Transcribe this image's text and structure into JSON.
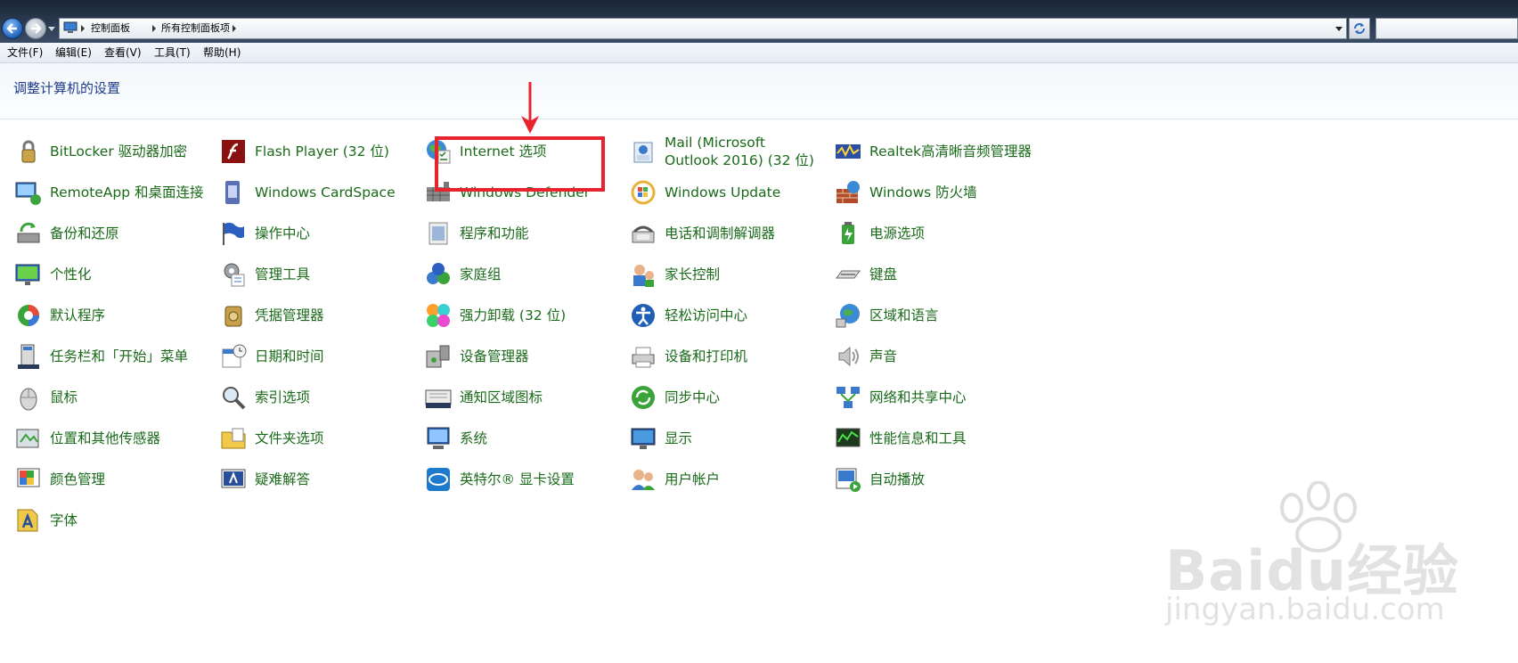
{
  "window": {
    "breadcrumb": [
      "控制面板",
      "所有控制面板项"
    ]
  },
  "menu": [
    "文件(F)",
    "编辑(E)",
    "查看(V)",
    "工具(T)",
    "帮助(H)"
  ],
  "heading": "调整计算机的设置",
  "items": [
    {
      "label": "BitLocker 驱动器加密",
      "icon": "bitlocker-icon"
    },
    {
      "label": "Flash Player (32 位)",
      "icon": "flash-icon"
    },
    {
      "label": "Internet 选项",
      "icon": "internet-options-icon"
    },
    {
      "label": "Mail (Microsoft Outlook 2016) (32 位)",
      "icon": "mail-icon"
    },
    {
      "label": "Realtek高清晰音频管理器",
      "icon": "realtek-audio-icon"
    },
    {
      "label": "RemoteApp 和桌面连接",
      "icon": "remoteapp-icon"
    },
    {
      "label": "Windows CardSpace",
      "icon": "cardspace-icon"
    },
    {
      "label": "Windows Defender",
      "icon": "defender-icon"
    },
    {
      "label": "Windows Update",
      "icon": "windows-update-icon"
    },
    {
      "label": "Windows 防火墙",
      "icon": "firewall-icon"
    },
    {
      "label": "备份和还原",
      "icon": "backup-icon"
    },
    {
      "label": "操作中心",
      "icon": "action-center-icon"
    },
    {
      "label": "程序和功能",
      "icon": "programs-icon"
    },
    {
      "label": "电话和调制解调器",
      "icon": "phone-modem-icon"
    },
    {
      "label": "电源选项",
      "icon": "power-icon"
    },
    {
      "label": "个性化",
      "icon": "personalization-icon"
    },
    {
      "label": "管理工具",
      "icon": "admin-tools-icon"
    },
    {
      "label": "家庭组",
      "icon": "homegroup-icon"
    },
    {
      "label": "家长控制",
      "icon": "parental-controls-icon"
    },
    {
      "label": "键盘",
      "icon": "keyboard-icon"
    },
    {
      "label": "默认程序",
      "icon": "default-programs-icon"
    },
    {
      "label": "凭据管理器",
      "icon": "credential-manager-icon"
    },
    {
      "label": "强力卸载 (32 位)",
      "icon": "uninstaller-icon"
    },
    {
      "label": "轻松访问中心",
      "icon": "ease-of-access-icon"
    },
    {
      "label": "区域和语言",
      "icon": "region-language-icon"
    },
    {
      "label": "任务栏和「开始」菜单",
      "icon": "taskbar-icon"
    },
    {
      "label": "日期和时间",
      "icon": "date-time-icon"
    },
    {
      "label": "设备管理器",
      "icon": "device-manager-icon"
    },
    {
      "label": "设备和打印机",
      "icon": "devices-printers-icon"
    },
    {
      "label": "声音",
      "icon": "sound-icon"
    },
    {
      "label": "鼠标",
      "icon": "mouse-icon"
    },
    {
      "label": "索引选项",
      "icon": "indexing-icon"
    },
    {
      "label": "通知区域图标",
      "icon": "notification-icons-icon"
    },
    {
      "label": "同步中心",
      "icon": "sync-center-icon"
    },
    {
      "label": "网络和共享中心",
      "icon": "network-center-icon"
    },
    {
      "label": "位置和其他传感器",
      "icon": "location-sensors-icon"
    },
    {
      "label": "文件夹选项",
      "icon": "folder-options-icon"
    },
    {
      "label": "系统",
      "icon": "system-icon"
    },
    {
      "label": "显示",
      "icon": "display-icon"
    },
    {
      "label": "性能信息和工具",
      "icon": "performance-icon"
    },
    {
      "label": "颜色管理",
      "icon": "color-management-icon"
    },
    {
      "label": "疑难解答",
      "icon": "troubleshooting-icon"
    },
    {
      "label": "英特尔® 显卡设置",
      "icon": "intel-graphics-icon"
    },
    {
      "label": "用户帐户",
      "icon": "user-accounts-icon"
    },
    {
      "label": "自动播放",
      "icon": "autoplay-icon"
    },
    {
      "label": "字体",
      "icon": "fonts-icon"
    }
  ],
  "watermark": {
    "logo": "Baidu经验",
    "url": "jingyan.baidu.com"
  },
  "colors": {
    "link": "#1a6a1a",
    "heading": "#1e3b8a",
    "highlight": "#e8232e"
  }
}
